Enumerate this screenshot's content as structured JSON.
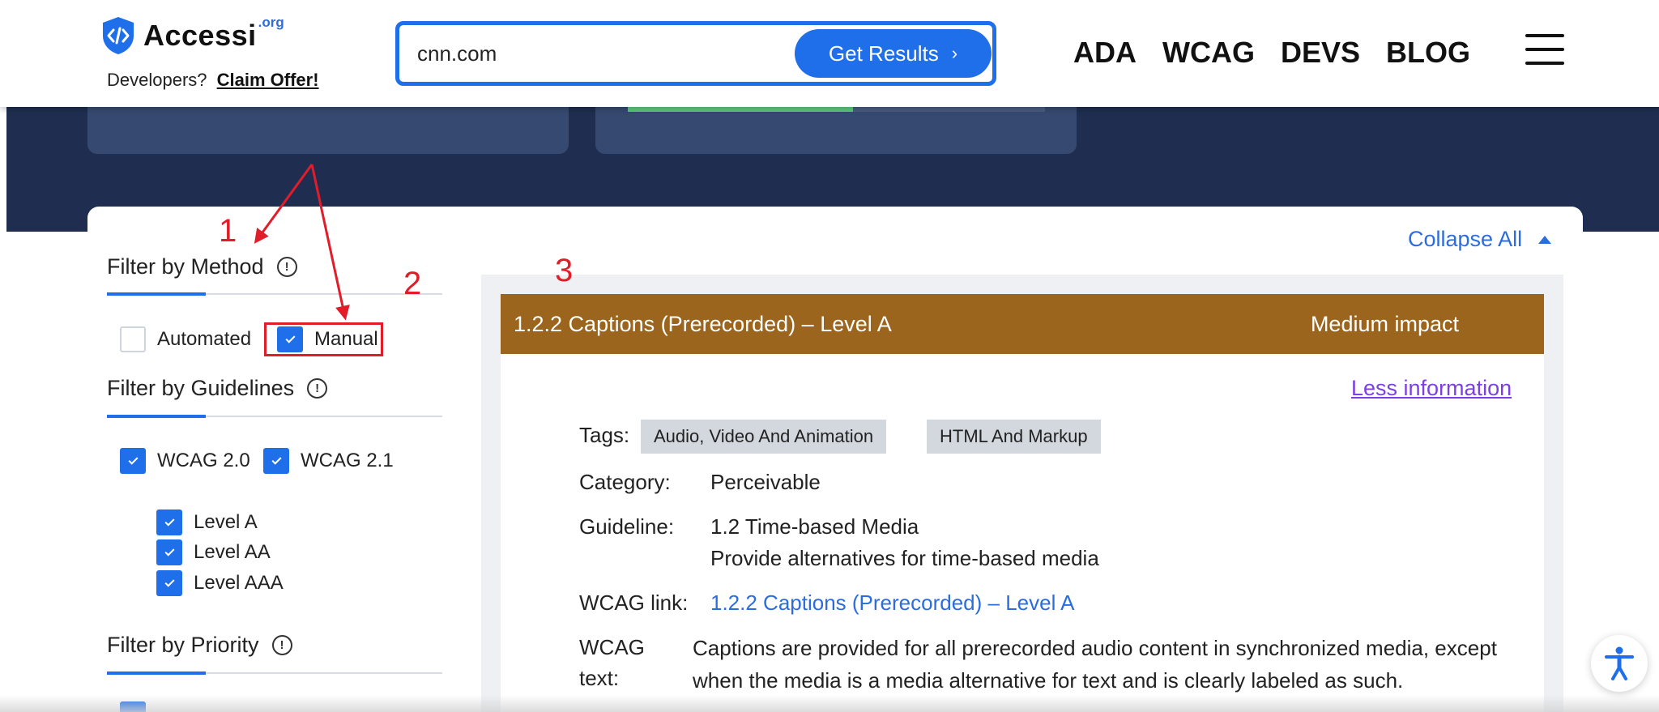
{
  "header": {
    "logo_text": "Accessi",
    "logo_sup": ".org",
    "dev_prompt": "Developers?",
    "claim_offer": "Claim Offer!",
    "search_value": "cnn.com",
    "search_button": "Get Results",
    "nav": [
      "ADA",
      "WCAG",
      "DEVS",
      "BLOG"
    ],
    "menu_icon": "hamburger-menu-icon"
  },
  "band": {
    "progress_fraction": 0.54
  },
  "collapse_all": "Collapse All",
  "filters": {
    "method": {
      "title": "Filter by Method",
      "options": [
        {
          "label": "Automated",
          "checked": false
        },
        {
          "label": "Manual",
          "checked": true
        }
      ]
    },
    "guidelines": {
      "title": "Filter by Guidelines",
      "versions": [
        {
          "label": "WCAG 2.0",
          "checked": true
        },
        {
          "label": "WCAG 2.1",
          "checked": true
        }
      ],
      "levels": [
        {
          "label": "Level A",
          "checked": true
        },
        {
          "label": "Level AA",
          "checked": true
        },
        {
          "label": "Level AAA",
          "checked": true
        }
      ]
    },
    "priority": {
      "title": "Filter by Priority"
    }
  },
  "annotations": [
    "1",
    "2",
    "3"
  ],
  "result": {
    "title": "1.2.2 Captions (Prerecorded) – Level A",
    "impact": "Medium impact",
    "less_info": "Less information",
    "tags_label": "Tags:",
    "tags": [
      "Audio, Video And Animation",
      "HTML And Markup"
    ],
    "category_label": "Category:",
    "category": "Perceivable",
    "guideline_label": "Guideline:",
    "guideline": "1.2 Time-based Media",
    "guideline_desc": "Provide alternatives for time-based media",
    "wcag_link_label": "WCAG link:",
    "wcag_link": "1.2.2 Captions (Prerecorded) – Level A",
    "wcag_text_label_1": "WCAG",
    "wcag_text_label_2": "text:",
    "wcag_text": "Captions are provided for all prerecorded audio content in synchronized media, except when the media is a media alternative for text and is clearly labeled as such."
  },
  "colors": {
    "brand_blue": "#1f6feb",
    "impact_header": "#9b651d",
    "annotation_red": "#e11d2a",
    "dark_band": "#1f2e50"
  }
}
